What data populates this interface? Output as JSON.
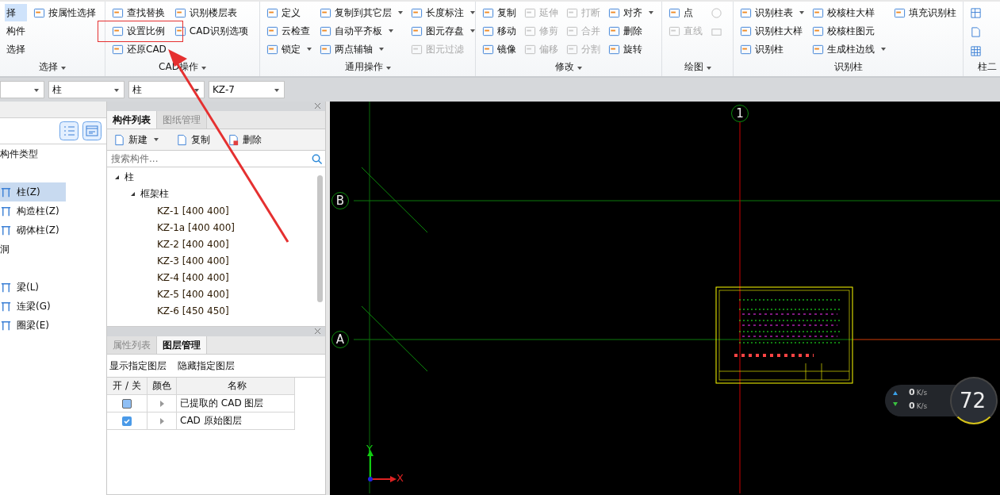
{
  "ribbon": {
    "groups": [
      {
        "label": "选择",
        "columns": [
          [
            {
              "label": "择",
              "dropdown": false,
              "disabled": false,
              "selected": true
            },
            {
              "label": "构件",
              "dropdown": false,
              "disabled": false,
              "selected": false
            },
            {
              "label": "选择",
              "dropdown": false,
              "disabled": false,
              "selected": false
            }
          ],
          [
            {
              "label": "按属性选择",
              "dropdown": false,
              "disabled": false,
              "selected": false
            }
          ]
        ]
      },
      {
        "label": "CAD操作",
        "columns": [
          [
            {
              "label": "查找替换",
              "dropdown": false,
              "disabled": false,
              "selected": false
            },
            {
              "label": "设置比例",
              "dropdown": false,
              "disabled": false,
              "selected": false
            },
            {
              "label": "还原CAD",
              "dropdown": false,
              "disabled": false,
              "selected": false
            }
          ],
          [
            {
              "label": "识别楼层表",
              "dropdown": false,
              "disabled": false,
              "selected": false
            },
            {
              "label": "CAD识别选项",
              "dropdown": false,
              "disabled": false,
              "selected": false
            }
          ]
        ]
      },
      {
        "label": "通用操作",
        "columns": [
          [
            {
              "label": "定义",
              "dropdown": false,
              "disabled": false,
              "selected": false
            },
            {
              "label": "云检查",
              "dropdown": false,
              "disabled": false,
              "selected": false
            },
            {
              "label": "锁定",
              "dropdown": true,
              "disabled": false,
              "selected": false
            }
          ],
          [
            {
              "label": "复制到其它层",
              "dropdown": true,
              "disabled": false,
              "selected": false
            },
            {
              "label": "自动平齐板",
              "dropdown": true,
              "disabled": false,
              "selected": false
            },
            {
              "label": "两点辅轴",
              "dropdown": true,
              "disabled": false,
              "selected": false
            }
          ],
          [
            {
              "label": "长度标注",
              "dropdown": true,
              "disabled": false,
              "selected": false
            },
            {
              "label": "图元存盘",
              "dropdown": true,
              "disabled": false,
              "selected": false
            },
            {
              "label": "图元过滤",
              "dropdown": false,
              "disabled": true,
              "selected": false
            }
          ]
        ]
      },
      {
        "label": "修改",
        "columns": [
          [
            {
              "label": "复制",
              "dropdown": false,
              "disabled": false,
              "selected": false
            },
            {
              "label": "移动",
              "dropdown": false,
              "disabled": false,
              "selected": false
            },
            {
              "label": "镜像",
              "dropdown": false,
              "disabled": false,
              "selected": false
            }
          ],
          [
            {
              "label": "延伸",
              "dropdown": false,
              "disabled": true,
              "selected": false
            },
            {
              "label": "修剪",
              "dropdown": false,
              "disabled": true,
              "selected": false
            },
            {
              "label": "偏移",
              "dropdown": false,
              "disabled": true,
              "selected": false
            }
          ],
          [
            {
              "label": "打断",
              "dropdown": false,
              "disabled": true,
              "selected": false
            },
            {
              "label": "合并",
              "dropdown": false,
              "disabled": true,
              "selected": false
            },
            {
              "label": "分割",
              "dropdown": false,
              "disabled": true,
              "selected": false
            }
          ],
          [
            {
              "label": "对齐",
              "dropdown": true,
              "disabled": false,
              "selected": false
            },
            {
              "label": "删除",
              "dropdown": false,
              "disabled": false,
              "selected": false
            },
            {
              "label": "旋转",
              "dropdown": false,
              "disabled": false,
              "selected": false
            }
          ]
        ]
      },
      {
        "label": "绘图",
        "columns": [
          [
            {
              "label": "点",
              "dropdown": false,
              "disabled": false,
              "selected": false
            },
            {
              "label": "直线",
              "dropdown": false,
              "disabled": true,
              "selected": false
            }
          ]
        ]
      },
      {
        "label": "识别柱",
        "columns": [
          [
            {
              "label": "识别柱表",
              "dropdown": true,
              "disabled": false,
              "selected": false
            },
            {
              "label": "识别柱大样",
              "dropdown": false,
              "disabled": false,
              "selected": false
            },
            {
              "label": "识别柱",
              "dropdown": false,
              "disabled": false,
              "selected": false
            }
          ],
          [
            {
              "label": "校核柱大样",
              "dropdown": false,
              "disabled": false,
              "selected": false
            },
            {
              "label": "校核柱图元",
              "dropdown": false,
              "disabled": false,
              "selected": false
            },
            {
              "label": "生成柱边线",
              "dropdown": true,
              "disabled": false,
              "selected": false
            }
          ],
          [
            {
              "label": "填充识别柱",
              "dropdown": false,
              "disabled": false,
              "selected": false
            }
          ]
        ]
      },
      {
        "label": "柱二"
      }
    ]
  },
  "selectors": [
    {
      "kind": "empty"
    },
    {
      "kind": "text",
      "value": "柱"
    },
    {
      "kind": "text",
      "value": "柱"
    },
    {
      "kind": "text",
      "value": "KZ-7"
    }
  ],
  "left_panel": {
    "items": [
      {
        "label": "构件类型",
        "kind": "heading",
        "selected": false
      },
      {
        "label": "柱(Z)",
        "kind": "item",
        "selected": true
      },
      {
        "label": "构造柱(Z)",
        "kind": "item",
        "selected": false
      },
      {
        "label": "砌体柱(Z)",
        "kind": "item",
        "selected": false
      },
      {
        "label": "洞",
        "kind": "heading",
        "selected": false
      },
      {
        "label": "梁(L)",
        "kind": "item",
        "selected": false
      },
      {
        "label": "连梁(G)",
        "kind": "item",
        "selected": false
      },
      {
        "label": "圈梁(E)",
        "kind": "item",
        "selected": false
      }
    ]
  },
  "component_panel": {
    "tabs": [
      {
        "label": "构件列表",
        "selected": true
      },
      {
        "label": "图纸管理",
        "selected": false
      }
    ],
    "toolbar": [
      {
        "label": "新建",
        "dropdown": true
      },
      {
        "label": "复制",
        "dropdown": false
      },
      {
        "label": "删除",
        "dropdown": false
      }
    ],
    "search": {
      "placeholder": "搜索构件..."
    },
    "tree": [
      {
        "label": "柱",
        "expanded": true,
        "children": [
          {
            "label": "框架柱",
            "expanded": true,
            "children": [
              {
                "label": "KZ-1 [400 400]"
              },
              {
                "label": "KZ-1a [400 400]"
              },
              {
                "label": "KZ-2 [400 400]"
              },
              {
                "label": "KZ-3 [400 400]"
              },
              {
                "label": "KZ-4 [400 400]"
              },
              {
                "label": "KZ-5 [400 400]"
              },
              {
                "label": "KZ-6 [450 450]"
              }
            ]
          }
        ]
      }
    ]
  },
  "layer_panel": {
    "tabs": [
      {
        "label": "属性列表",
        "selected": false
      },
      {
        "label": "图层管理",
        "selected": true
      }
    ],
    "actions": [
      "显示指定图层",
      "隐藏指定图层"
    ],
    "columns": [
      "开 / 关",
      "颜色",
      "名称"
    ],
    "rows": [
      {
        "checked": false,
        "name": "已提取的 CAD 图层"
      },
      {
        "checked": true,
        "name": "CAD 原始图层"
      }
    ]
  },
  "canvas": {
    "axes": [
      "1",
      "B",
      "A"
    ],
    "axis_labels": [
      "X",
      "Y"
    ]
  },
  "speed_widget": {
    "upload": "0",
    "upload_unit": "K/s",
    "download": "0",
    "download_unit": "K/s",
    "gauge": "72"
  }
}
